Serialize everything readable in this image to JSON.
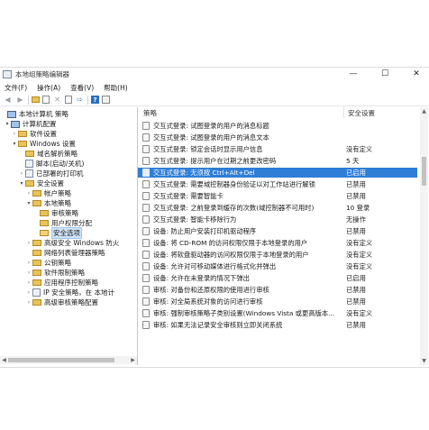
{
  "window": {
    "title": "本地组策略编辑器",
    "controls": {
      "minimize": "—",
      "maximize": "☐",
      "close": "✕"
    }
  },
  "menu": [
    "文件(F)",
    "操作(A)",
    "查看(V)",
    "帮助(H)"
  ],
  "tree": [
    {
      "label": "本地计算机 策略",
      "icon": "computer-icon",
      "twisty": ""
    },
    {
      "label": "计算机配置",
      "icon": "computer-icon",
      "twisty": "▾"
    },
    {
      "label": "软件设置",
      "icon": "folder-icon",
      "twisty": "›"
    },
    {
      "label": "Windows 设置",
      "icon": "folder-icon",
      "twisty": "▾"
    },
    {
      "label": "域名解析策略",
      "icon": "folder-icon",
      "twisty": ""
    },
    {
      "label": "脚本(启动/关机)",
      "icon": "script-icon",
      "twisty": ""
    },
    {
      "label": "已部署的打印机",
      "icon": "printer-icon",
      "twisty": "›"
    },
    {
      "label": "安全设置",
      "icon": "folder-icon",
      "twisty": "▾"
    },
    {
      "label": "帐户策略",
      "icon": "folder-icon",
      "twisty": "›"
    },
    {
      "label": "本地策略",
      "icon": "folder-icon",
      "twisty": "▾"
    },
    {
      "label": "审核策略",
      "icon": "folder-icon",
      "twisty": ""
    },
    {
      "label": "用户权限分配",
      "icon": "folder-icon",
      "twisty": ""
    },
    {
      "label": "安全选项",
      "icon": "folder-icon",
      "twisty": "",
      "selected": true
    },
    {
      "label": "高级安全 Windows 防火",
      "icon": "folder-icon",
      "twisty": "›"
    },
    {
      "label": "网络列表管理器策略",
      "icon": "folder-icon",
      "twisty": ""
    },
    {
      "label": "公钥策略",
      "icon": "folder-icon",
      "twisty": "›"
    },
    {
      "label": "软件限制策略",
      "icon": "folder-icon",
      "twisty": "›"
    },
    {
      "label": "应用程序控制策略",
      "icon": "folder-icon",
      "twisty": "›"
    },
    {
      "label": "IP 安全策略，在 本地计",
      "icon": "network-icon",
      "twisty": "›"
    },
    {
      "label": "高级审核策略配置",
      "icon": "folder-icon",
      "twisty": "›"
    }
  ],
  "columns": {
    "policy": "策略",
    "setting": "安全设置"
  },
  "rows": [
    {
      "policy": "交互式登录: 试图登录的用户的消息标题",
      "setting": ""
    },
    {
      "policy": "交互式登录: 试图登录的用户的消息文本",
      "setting": ""
    },
    {
      "policy": "交互式登录: 锁定会话时显示用户信息",
      "setting": "没有定义"
    },
    {
      "policy": "交互式登录: 提示用户在过期之前更改密码",
      "setting": "5 天"
    },
    {
      "policy": "交互式登录: 无须按 Ctrl+Alt+Del",
      "setting": "已启用",
      "selected": true
    },
    {
      "policy": "交互式登录: 需要域控制器身份验证以对工作站进行解锁",
      "setting": "已禁用"
    },
    {
      "policy": "交互式登录: 需要智能卡",
      "setting": "已禁用"
    },
    {
      "policy": "交互式登录: 之前登录到缓存的次数(域控制器不可用时)",
      "setting": "10 登录"
    },
    {
      "policy": "交互式登录: 智能卡移除行为",
      "setting": "无操作"
    },
    {
      "policy": "设备: 防止用户安装打印机驱动程序",
      "setting": "已禁用"
    },
    {
      "policy": "设备: 将 CD-ROM 的访问权限仅限于本地登录的用户",
      "setting": "没有定义"
    },
    {
      "policy": "设备: 将软盘驱动器的访问权限仅限于本地登录的用户",
      "setting": "没有定义"
    },
    {
      "policy": "设备: 允许对可移动媒体进行格式化并弹出",
      "setting": "没有定义"
    },
    {
      "policy": "设备: 允许在未登录的情况下弹出",
      "setting": "已启用"
    },
    {
      "policy": "审核: 对备份和还原权限的使用进行审核",
      "setting": "已禁用"
    },
    {
      "policy": "审核: 对全局系统对象的访问进行审核",
      "setting": "已禁用"
    },
    {
      "policy": "审核: 强制审核策略子类别设置(Windows Vista 或更高版本...",
      "setting": "没有定义"
    },
    {
      "policy": "审核: 如果无法记录安全审核则立即关闭系统",
      "setting": "已禁用"
    }
  ],
  "colors": {
    "selection": "#2f7ed8",
    "folder": "#e8c35a"
  }
}
